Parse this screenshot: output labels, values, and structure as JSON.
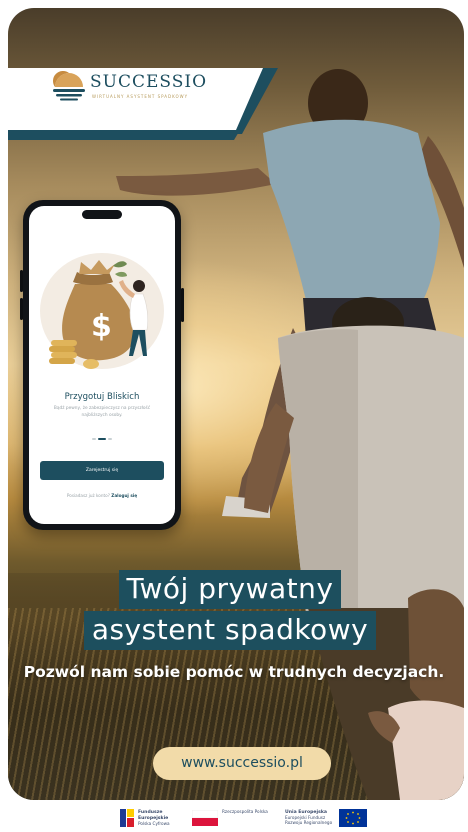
{
  "logo": {
    "name": "SUCCESSIO",
    "tagline": "WIRTUALNY ASYSTENT SPADKOWY"
  },
  "app_screen": {
    "heading": "Przygotuj Bliskich",
    "body": "Bądź pewny, że zabezpieczysz na przyszłość najbliższych osoby.",
    "register_button": "Zarejestruj się",
    "login_prompt": "Posiadasz już konto?",
    "login_link": "Zaloguj się"
  },
  "headline": {
    "line1": "Twój prywatny",
    "line2": "asystent spadkowy"
  },
  "subheadline": "Pozwól nam sobie pomóc w trudnych decyzjach.",
  "website": "www.successio.pl",
  "funding": {
    "fe_title": "Fundusze Europejskie",
    "fe_sub": "Polska Cyfrowa",
    "rp_title": "Rzeczpospolita Polska",
    "ue_title": "Unia Europejska",
    "ue_sub": "Europejski Fundusz Rozwoju Regionalnego"
  },
  "colors": {
    "brand_teal": "#1d4e5f",
    "accent_gold": "#b69a5a",
    "pill_cream": "#f2dba9"
  }
}
